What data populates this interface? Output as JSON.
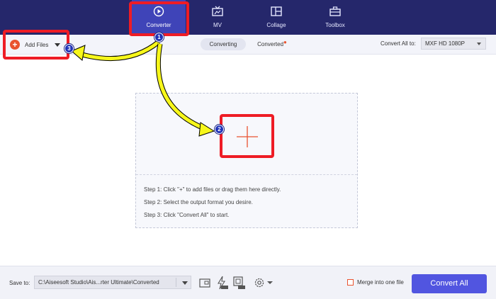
{
  "nav": {
    "tabs": [
      {
        "label": "Converter",
        "icon": "play-circle-icon",
        "active": true
      },
      {
        "label": "MV",
        "icon": "tv-icon",
        "active": false
      },
      {
        "label": "Collage",
        "icon": "collage-icon",
        "active": false
      },
      {
        "label": "Toolbox",
        "icon": "toolbox-icon",
        "active": false
      }
    ]
  },
  "toolbar": {
    "add_files_label": "Add Files",
    "segments": [
      "Converting",
      "Converted"
    ],
    "convert_all_to_label": "Convert All to:",
    "format_value": "MXF HD 1080P"
  },
  "dropzone": {
    "steps": [
      "Step 1: Click \"+\" to add files or drag them here directly.",
      "Step 2: Select the output format you desire.",
      "Step 3: Click \"Convert All\" to start."
    ]
  },
  "bottom": {
    "save_to_label": "Save to:",
    "path_value": "C:\\Aiseesoft Studio\\Ais...rter Ultimate\\Converted",
    "merge_label": "Merge into one file",
    "convert_all_label": "Convert All"
  },
  "annotations": {
    "badges": [
      "1",
      "2",
      "3"
    ]
  },
  "colors": {
    "nav_bg": "#25276b",
    "accent": "#5155e0",
    "highlight": "#ee1c25",
    "arrow": "#f7f71a",
    "add_orange": "#e9532f"
  }
}
